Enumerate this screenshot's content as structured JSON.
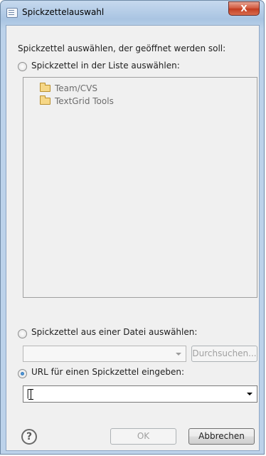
{
  "window": {
    "title": "Spickzettelauswahl",
    "close_glyph": "X"
  },
  "prompt": "Spickzettel auswählen, der geöffnet werden soll:",
  "option_list": {
    "label": "Spickzettel in der Liste auswählen:",
    "selected": false,
    "items": [
      {
        "icon": "folder-icon",
        "label": "Team/CVS"
      },
      {
        "icon": "folder-icon",
        "label": "TextGrid Tools"
      }
    ]
  },
  "option_file": {
    "label": "Spickzettel aus einer Datei auswählen:",
    "selected": false,
    "file_value": "",
    "browse_label": "Durchsuchen..."
  },
  "option_url": {
    "label": "URL für einen Spickzettel eingeben:",
    "selected": true,
    "url_value": "|"
  },
  "footer": {
    "help_glyph": "?",
    "ok_label": "OK",
    "cancel_label": "Abbrechen"
  },
  "colors": {
    "titlebar": "#a9c4e2",
    "close_button": "#c23c20",
    "client_background": "#f0f0f0"
  }
}
